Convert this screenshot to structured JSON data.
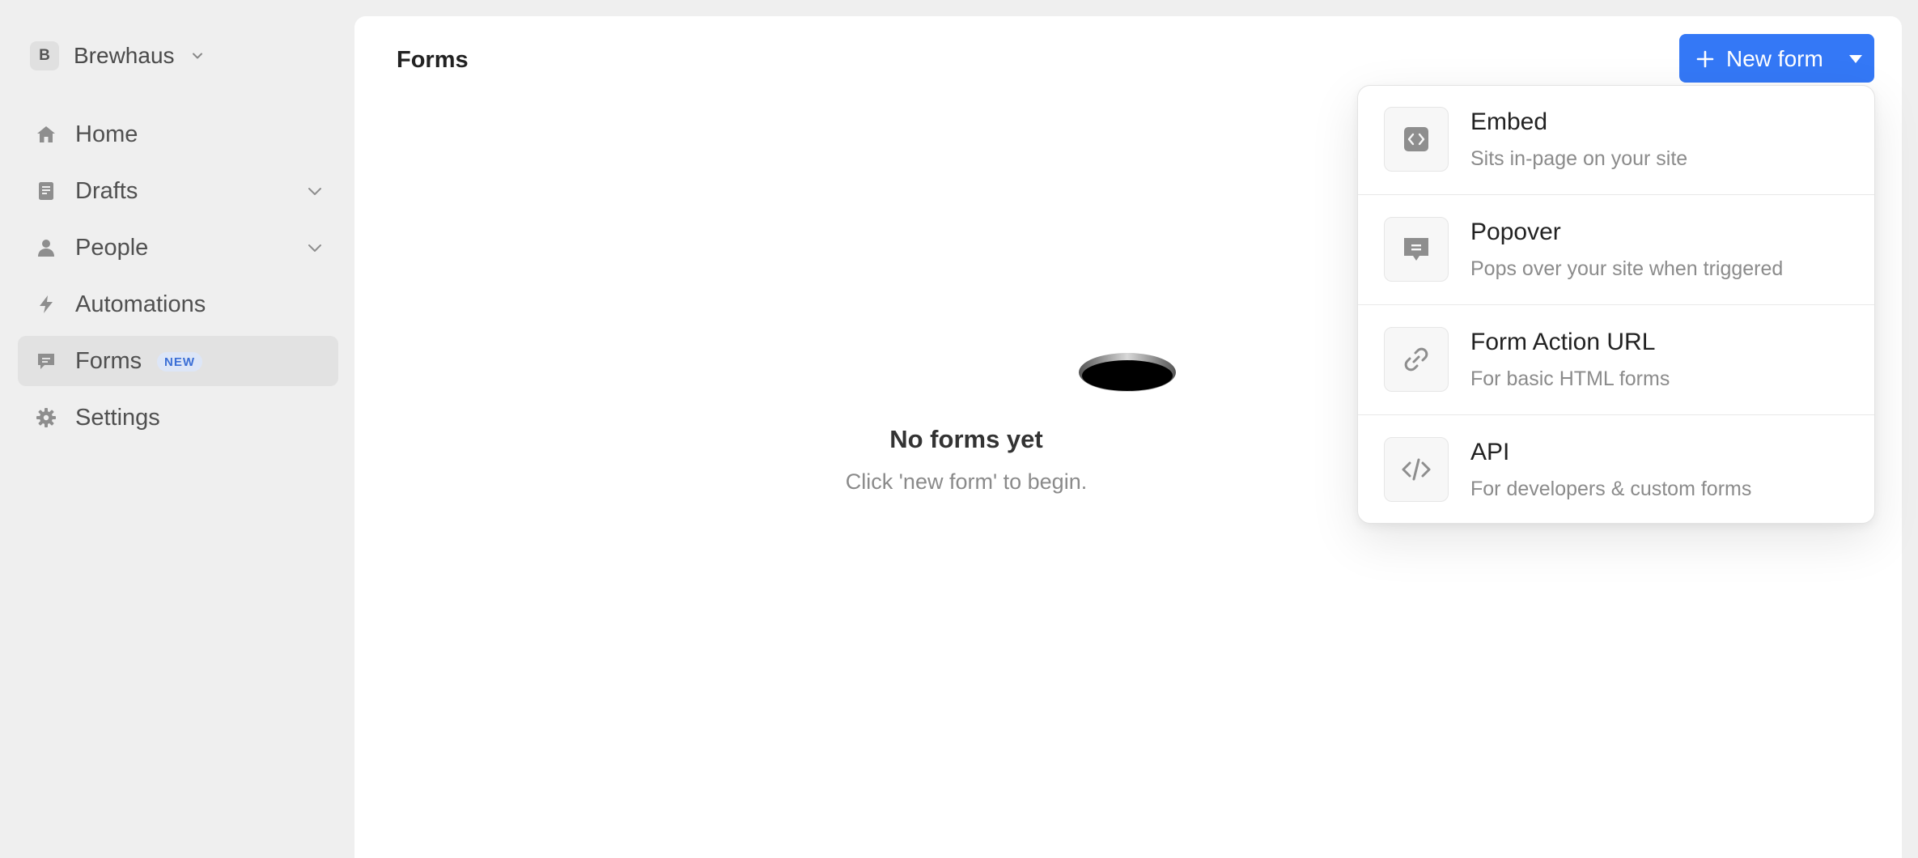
{
  "workspace": {
    "initial": "B",
    "name": "Brewhaus"
  },
  "sidebar": {
    "items": [
      {
        "label": "Home"
      },
      {
        "label": "Drafts"
      },
      {
        "label": "People"
      },
      {
        "label": "Automations"
      },
      {
        "label": "Forms",
        "badge": "NEW",
        "active": true
      },
      {
        "label": "Settings"
      }
    ]
  },
  "main": {
    "title": "Forms",
    "new_button": "New form",
    "empty": {
      "title": "No forms yet",
      "subtitle": "Click 'new form' to begin."
    }
  },
  "dropdown": {
    "items": [
      {
        "title": "Embed",
        "desc": "Sits in-page on your site",
        "icon": "embed-icon"
      },
      {
        "title": "Popover",
        "desc": "Pops over your site when triggered",
        "icon": "chat-bubble-icon"
      },
      {
        "title": "Form Action URL",
        "desc": "For basic HTML forms",
        "icon": "link-icon"
      },
      {
        "title": "API",
        "desc": "For developers & custom forms",
        "icon": "code-icon"
      }
    ]
  },
  "colors": {
    "accent": "#3478f6",
    "sidebar_bg": "#efefef",
    "active_item_bg": "#e2e2e2",
    "badge_bg": "#dde6f7",
    "badge_text": "#3b6fd6"
  }
}
